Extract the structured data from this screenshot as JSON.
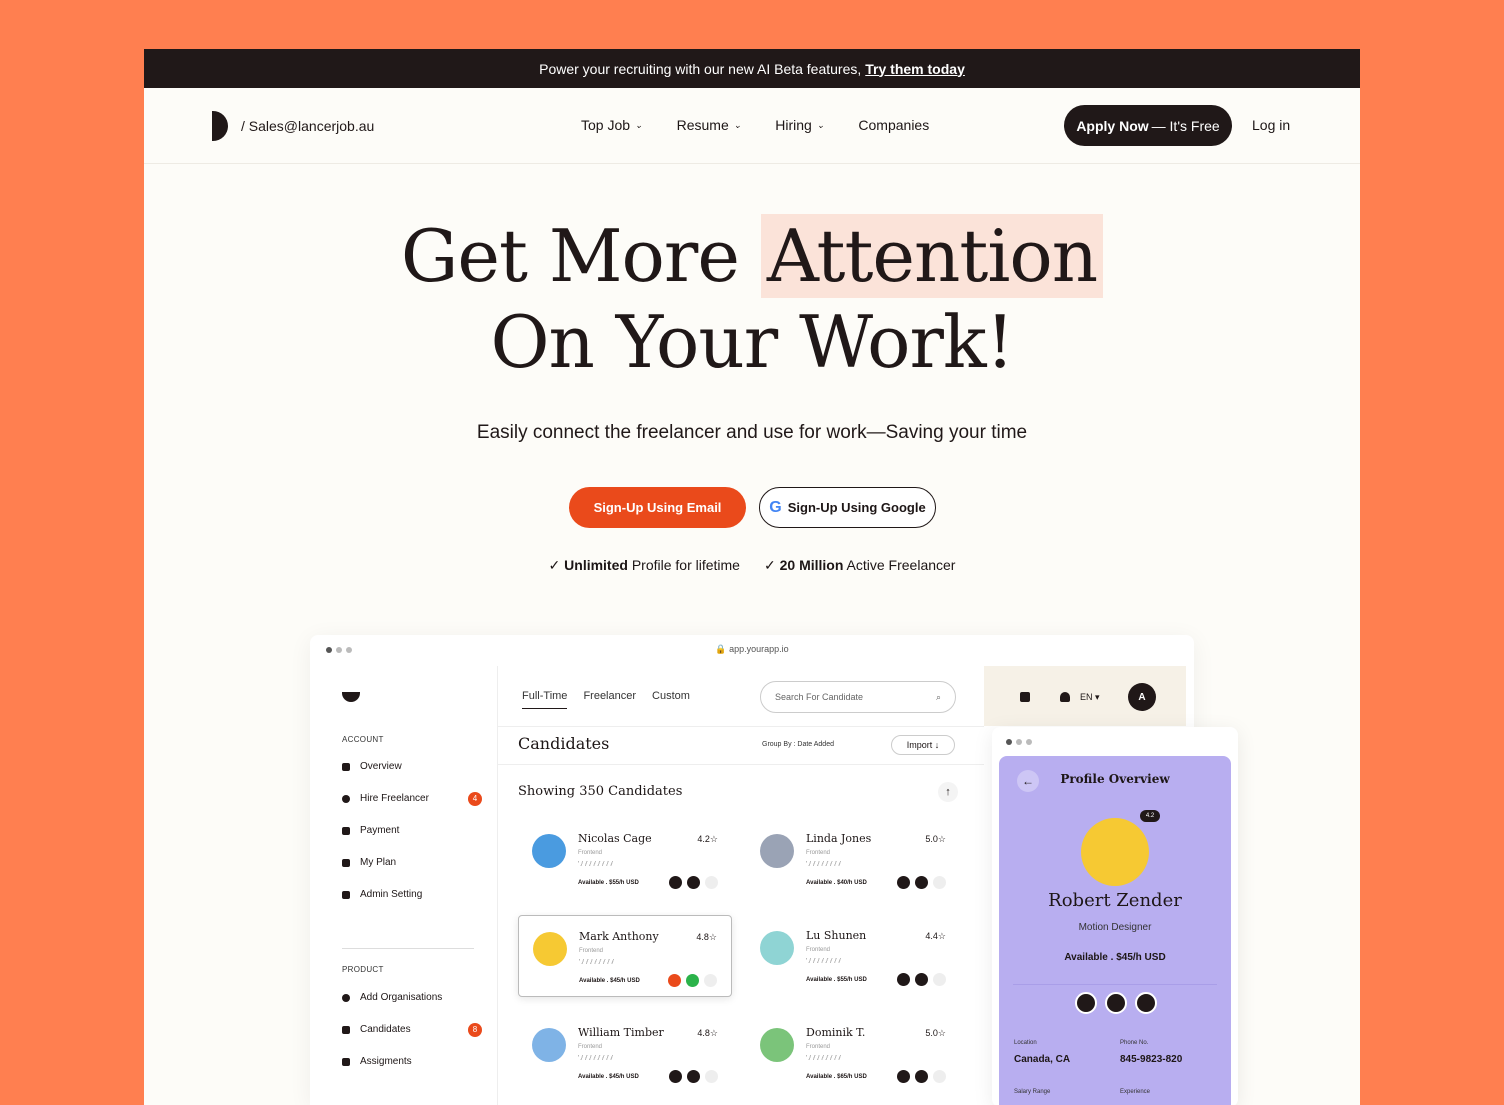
{
  "banner": {
    "text": "Power your recruiting with our new AI Beta features,",
    "link": "Try them today"
  },
  "nav": {
    "email": "/ Sales@lancerjob.au",
    "items": [
      {
        "label": "Top Job"
      },
      {
        "label": "Resume"
      },
      {
        "label": "Hiring"
      },
      {
        "label": "Companies"
      }
    ],
    "apply_bold": "Apply Now",
    "apply_rest": "— It's Free",
    "login": "Log in"
  },
  "hero": {
    "line1a": "Get More",
    "line1b": "Attention",
    "line2": "On Your Work!",
    "subtitle": "Easily connect the freelancer and use for work—Saving your time"
  },
  "cta": {
    "email": "Sign-Up Using Email",
    "google": "Sign-Up Using Google"
  },
  "features": [
    {
      "bold": "Unlimited",
      "rest": "Profile for lifetime"
    },
    {
      "bold": "20 Million",
      "rest": "Active Freelancer"
    }
  ],
  "app": {
    "url": "app.yourapp.io",
    "sidebar": {
      "account": "ACCOUNT",
      "product": "PRODUCT",
      "items": [
        {
          "label": "Overview"
        },
        {
          "label": "Hire Freelancer",
          "badge": "4"
        },
        {
          "label": "Payment"
        },
        {
          "label": "My Plan"
        },
        {
          "label": "Admin Setting"
        }
      ],
      "product_items": [
        {
          "label": "Add Organisations"
        },
        {
          "label": "Candidates",
          "badge": "8"
        },
        {
          "label": "Assigments"
        }
      ]
    },
    "tabs": [
      "Full-Time",
      "Freelancer",
      "Custom"
    ],
    "search_placeholder": "Search For Candidate",
    "title": "Candidates",
    "group_by": "Group By : Date Added",
    "import": "Import",
    "showing": "Showing 350 Candidates",
    "lang": "EN",
    "avatar": "A",
    "candidates": [
      {
        "name": "Nicolas Cage",
        "rating": "4.2",
        "role": "Frontend",
        "avail": "Available . $55/h USD",
        "color": "#4A9BE0"
      },
      {
        "name": "Linda Jones",
        "rating": "5.0",
        "role": "Frontend",
        "avail": "Available . $40/h USD",
        "color": "#9AA3B5"
      },
      {
        "name": "Mark Anthony",
        "rating": "4.8",
        "role": "Frontend",
        "avail": "Available . $45/h USD",
        "color": "#F6C933"
      },
      {
        "name": "Lu Shunen",
        "rating": "4.4",
        "role": "Frontend",
        "avail": "Available . $55/h USD",
        "color": "#8FD4D4"
      },
      {
        "name": "William Timber",
        "rating": "4.8",
        "role": "Frontend",
        "avail": "Available . $45/h USD",
        "color": "#7FB3E6"
      },
      {
        "name": "Dominik T.",
        "rating": "5.0",
        "role": "Frontend",
        "avail": "Available . $65/h USD",
        "color": "#7BC47A"
      }
    ]
  },
  "profile": {
    "title": "Profile Overview",
    "rating": "4.2",
    "name": "Robert Zender",
    "role": "Motion Designer",
    "avail": "Available . $45/h USD",
    "location_label": "Location",
    "location": "Canada, CA",
    "phone_label": "Phone No.",
    "phone": "845-9823-820",
    "salary_label": "Salary Range",
    "exp_label": "Experience"
  }
}
